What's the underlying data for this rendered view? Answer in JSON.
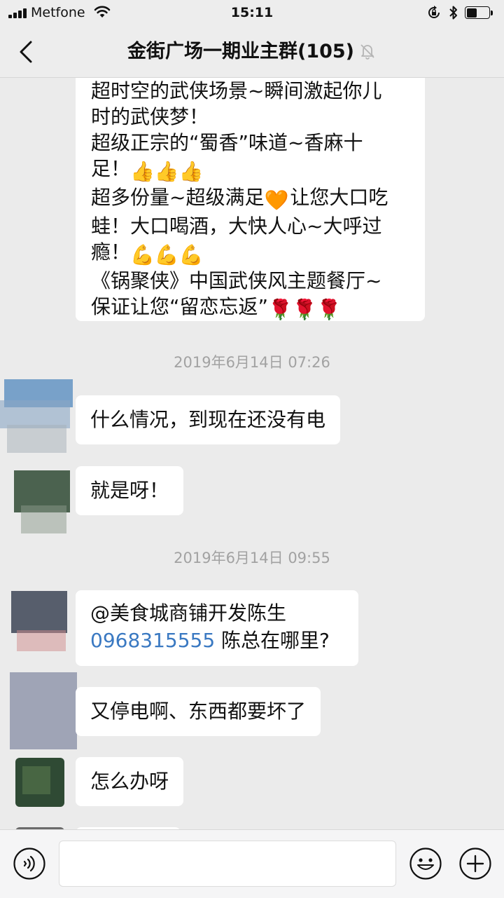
{
  "status_bar": {
    "carrier": "Metfone",
    "time": "15:11",
    "battery_level": 0.45
  },
  "nav": {
    "title": "金街广场一期业主群(105)"
  },
  "promo_message": {
    "lines": [
      {
        "text": "超时空的武侠场景~瞬间激起你儿"
      },
      {
        "text": "时的武侠梦！"
      },
      {
        "text": "超级正宗的“蜀香”味道~香麻十"
      },
      {
        "text": "足！",
        "emoji": "👍👍👍"
      },
      {
        "text": "超多份量~超级满足",
        "emoji": "🧡",
        "text_after": "让您大口吃"
      },
      {
        "text": "蛙！大口喝酒，大快人心~大呼过"
      },
      {
        "text": "瘾！",
        "emoji": "💪💪💪"
      },
      {
        "text": "《锅聚侠》中国武侠风主题餐厅~"
      },
      {
        "text": "保证让您“留恋忘返”",
        "emoji": "🌹🌹🌹"
      }
    ]
  },
  "timestamps": [
    "2019年6月14日 07:26",
    "2019年6月14日 09:55"
  ],
  "messages": [
    {
      "text": "什么情况，到现在还没有电"
    },
    {
      "text": "就是呀！"
    },
    {
      "mention": "@美食城商铺开发陈生",
      "phone": "0968315555",
      "text": " 陈总在哪里?"
    },
    {
      "text": " 又停电啊、东西都要坏了"
    },
    {
      "text": "怎么办呀"
    }
  ],
  "input": {
    "placeholder": "",
    "value": ""
  },
  "colors": {
    "background": "#ebebeb",
    "bubble": "#ffffff",
    "link": "#3a79c2",
    "timestamp": "#a2a2a2"
  },
  "icons": {
    "back": "chevron-left-icon",
    "mute": "bell-off-icon",
    "voice": "voice-icon",
    "emoji": "smiley-icon",
    "plus": "plus-icon"
  }
}
